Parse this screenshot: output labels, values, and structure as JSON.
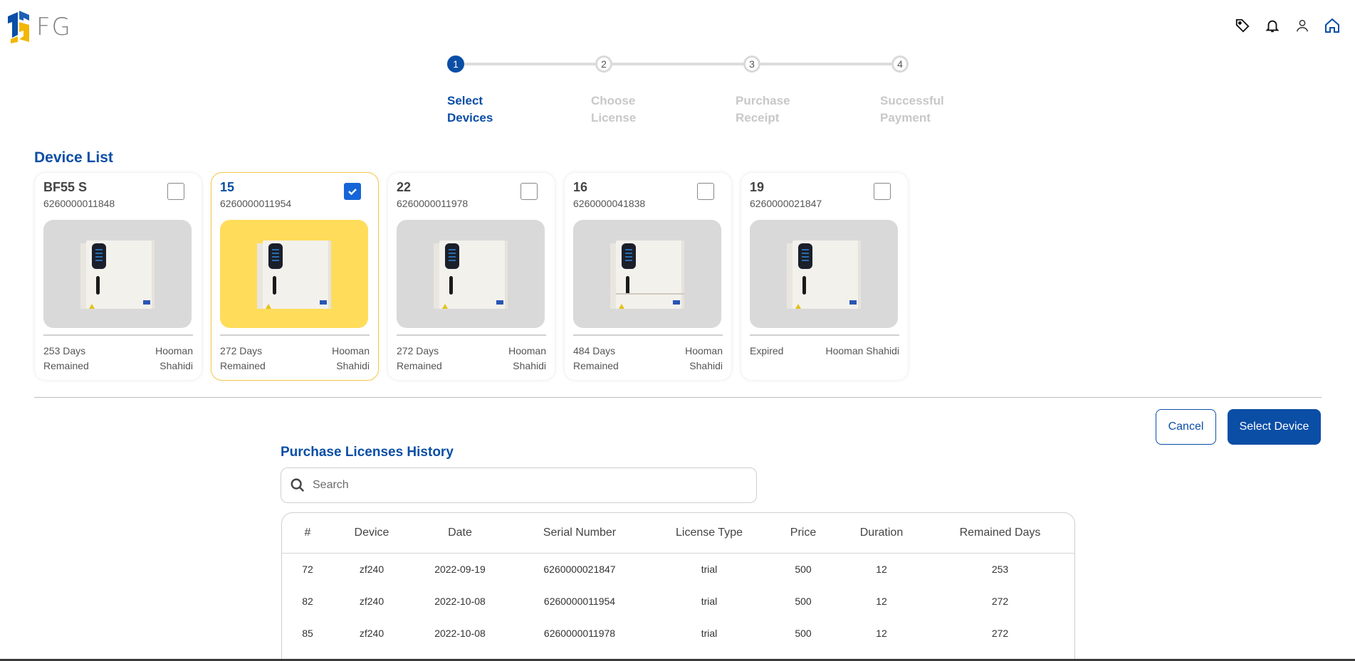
{
  "header": {
    "logo_text": "FG",
    "icons": [
      "tag-icon",
      "bell-icon",
      "user-icon",
      "home-icon"
    ]
  },
  "stepper": {
    "steps": [
      {
        "number": "1",
        "line1": "Select",
        "line2": "Devices",
        "active": true
      },
      {
        "number": "2",
        "line1": "Choose",
        "line2": "License",
        "active": false
      },
      {
        "number": "3",
        "line1": "Purchase",
        "line2": "Receipt",
        "active": false
      },
      {
        "number": "4",
        "line1": "Successful",
        "line2": "Payment",
        "active": false
      }
    ]
  },
  "device_list": {
    "title": "Device List",
    "devices": [
      {
        "name": "BF55 S",
        "serial": "6260000011848",
        "days_line1": "253 Days",
        "days_line2": "Remained",
        "owner_line1": "Hooman",
        "owner_line2": "Shahidi",
        "checked": false
      },
      {
        "name": "15",
        "serial": "6260000011954",
        "days_line1": "272 Days",
        "days_line2": "Remained",
        "owner_line1": "Hooman",
        "owner_line2": "Shahidi",
        "checked": true
      },
      {
        "name": "22",
        "serial": "6260000011978",
        "days_line1": "272 Days",
        "days_line2": "Remained",
        "owner_line1": "Hooman",
        "owner_line2": "Shahidi",
        "checked": false
      },
      {
        "name": "16",
        "serial": "6260000041838",
        "days_line1": "484 Days",
        "days_line2": "Remained",
        "owner_line1": "Hooman",
        "owner_line2": "Shahidi",
        "checked": false
      },
      {
        "name": "19",
        "serial": "6260000021847",
        "days_line1": "Expired",
        "days_line2": "",
        "owner_line1": "Hooman Shahidi",
        "owner_line2": "",
        "checked": false
      }
    ]
  },
  "actions": {
    "cancel_label": "Cancel",
    "select_label": "Select Device"
  },
  "history": {
    "title": "Purchase Licenses History",
    "search_placeholder": "Search",
    "columns": [
      "#",
      "Device",
      "Date",
      "Serial Number",
      "License Type",
      "Price",
      "Duration",
      "Remained Days"
    ],
    "rows": [
      [
        "72",
        "zf240",
        "2022-09-19",
        "6260000021847",
        "trial",
        "500",
        "12",
        "253"
      ],
      [
        "82",
        "zf240",
        "2022-10-08",
        "6260000011954",
        "trial",
        "500",
        "12",
        "272"
      ],
      [
        "85",
        "zf240",
        "2022-10-08",
        "6260000011978",
        "trial",
        "500",
        "12",
        "272"
      ]
    ]
  },
  "colors": {
    "primary": "#0a4ea6",
    "selected_card_bg": "#ffdc5a",
    "checkbox_checked": "#1565d8"
  }
}
